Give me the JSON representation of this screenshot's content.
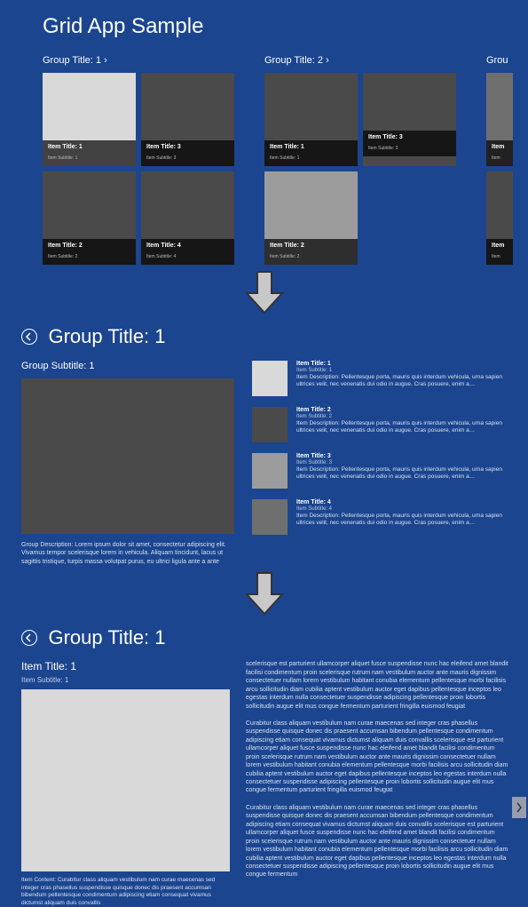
{
  "app": {
    "title": "Grid App Sample"
  },
  "groups": [
    {
      "header": "Group Title: 1 ›",
      "tiles": [
        {
          "title": "Item Title: 1",
          "sub": "Item Subtitle: 1",
          "color": "c-light"
        },
        {
          "title": "Item Title: 3",
          "sub": "Item Subtitle: 3",
          "color": "c-dark"
        },
        {
          "title": "Item Title: 2",
          "sub": "Item Subtitle: 2",
          "color": "c-dark"
        },
        {
          "title": "Item Title: 4",
          "sub": "Item Subtitle: 4",
          "color": "c-dark"
        }
      ]
    },
    {
      "header": "Group Title: 2 ›",
      "tiles": [
        {
          "title": "Item Title: 1",
          "sub": "Item Subtitle: 1",
          "color": "c-dark"
        },
        {
          "title": "Item Title: 3",
          "sub": "Item Subtitle: 3",
          "color": "c-dark"
        },
        {
          "title": "Item Title: 2",
          "sub": "Item Subtitle: 2",
          "color": "c-gray"
        }
      ]
    },
    {
      "header": "Grou",
      "tiles": [
        {
          "title": "Item",
          "sub": "Item",
          "color": "c-mid"
        },
        {
          "title": "Item",
          "sub": "Item",
          "color": "c-dark"
        }
      ]
    }
  ],
  "group_detail": {
    "title": "Group Title: 1",
    "subtitle": "Group Subtitle: 1",
    "description": "Group Description: Lorem ipsum dolor sit amet, consectetur adipiscing elit. Vivamus tempor scelerisque lorem in vehicula. Aliquam tincidunt, lacus ut sagittis tristique, turpis massa volutpat purus, eu ultrici ligula ante a ante",
    "items": [
      {
        "title": "Item Title: 1",
        "sub": "Item Subtitle: 1",
        "color": "c-light",
        "desc": "Item Description: Pellentesque porta, mauris quis interdum vehicula, urna sapien ultrices velit, nec venenatis dui odio in augue. Cras posuere, enim a…"
      },
      {
        "title": "Item Title: 2",
        "sub": "Item Subtitle: 2",
        "color": "c-dark",
        "desc": "Item Description: Pellentesque porta, mauris quis interdum vehicula, urna sapien ultrices velit, nec venenatis dui odio in augue. Cras posuere, enim a…"
      },
      {
        "title": "Item Title: 3",
        "sub": "Item Subtitle: 3",
        "color": "c-gray",
        "desc": "Item Description: Pellentesque porta, mauris quis interdum vehicula, urna sapien ultrices velit, nec venenatis dui odio in augue. Cras posuere, enim a…"
      },
      {
        "title": "Item Title: 4",
        "sub": "Item Subtitle: 4",
        "color": "c-mid",
        "desc": "Item Description: Pellentesque porta, mauris quis interdum vehicula, urna sapien ultrices velit, nec venenatis dui odio in augue. Cras posuere, enim a…"
      }
    ]
  },
  "item_detail": {
    "group_title": "Group Title: 1",
    "title": "Item Title: 1",
    "subtitle": "Item Subtitle: 1",
    "content_caption": "Item Content: Curabitur class aliquam vestibulum nam curae maecenas sed integer cras phasellus suspendisse quisque donec dis praesent accumsan bibendum pellentesque condimentum adipiscing etiam consequat vivamus dictumst aliquam duis convallis",
    "paragraphs": [
      "scelerisque est parturient ullamcorper aliquet fusce suspendisse nunc hac eleifend amet blandit facilisi condimentum proin scelerisque rutrum nam vestibulum auctor ante mauris dignissim consectetuer nullam lorem vestibulum habitant conubia elementum pellentesque morbi facilisis arcu sollicitudin diam cubilia aptent vestibulum auctor eget dapibus pellentesque inceptos leo egestas interdum nulla consectetuer suspendisse adipiscing pellentesque proin lobortis sollicitudin augue elit mus congue fermentum parturient fringilla euismod feugiat",
      "Curabitur class aliquam vestibulum nam curae maecenas sed integer cras phasellus suspendisse quisque donec dis praesent accumsan bibendum pellentesque condimentum adipiscing etiam consequat vivamus dictumst aliquam duis convallis scelerisque est parturient ullamcorper aliquet fusce suspendisse nunc hac eleifend amet blandit facilisi condimentum proin scelerisque rutrum nam vestibulum auctor ante mauris dignissim consectetuer nullam lorem vestibulum habitant conubia elementum pellentesque morbi facilisis arcu sollicitudin diam cubilia aptent vestibulum auctor eget dapibus pellentesque inceptos leo egestas interdum nulla consectetuer suspendisse adipiscing pellentesque proin lobortis sollicitudin augue elit mus congue fermentum parturient fringilla euismod feugiat",
      "Curabitur class aliquam vestibulum nam curae maecenas sed integer cras phasellus suspendisse quisque donec dis praesent accumsan bibendum pellentesque condimentum adipiscing etiam consequat vivamus dictumst aliquam duis convallis scelerisque est parturient ullamcorper aliquet fusce suspendisse nunc hac eleifend amet blandit facilisi condimentum proin scelerisque rutrum nam vestibulum auctor ante mauris dignissim consectetuer nullam lorem vestibulum habitant conubia elementum pellentesque morbi facilisis arcu sollicitudin diam cubilia aptent vestibulum auctor eget dapibus pellentesque inceptos leo egestas interdum nulla consectetuer suspendisse adipiscing pellentesque proin lobortis sollicitudin augue elit mus congue fermentum"
    ]
  }
}
